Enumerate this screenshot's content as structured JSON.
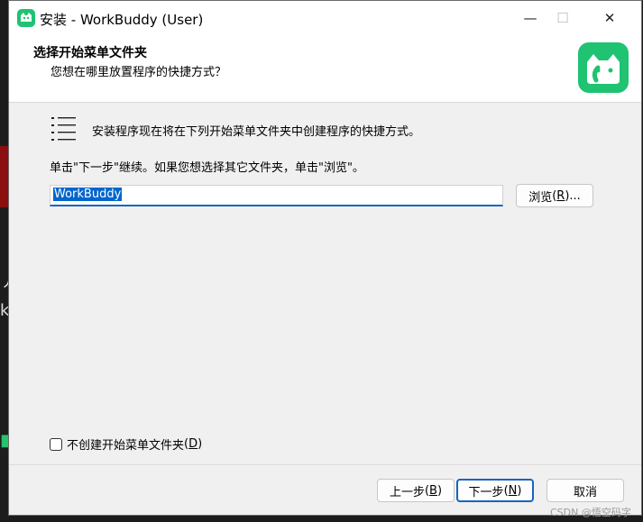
{
  "window": {
    "title": "安装 - WorkBuddy (User)",
    "minimize_glyph": "—",
    "maximize_glyph": "☐",
    "close_glyph": "✕"
  },
  "header": {
    "title": "选择开始菜单文件夹",
    "subtitle": "您想在哪里放置程序的快捷方式？",
    "logo_icon": "workbuddy-logo-icon"
  },
  "body": {
    "intro": "安装程序现在将在下列开始菜单文件夹中创建程序的快捷方式。",
    "instruction": "单击\"下一步\"继续。如果您想选择其它文件夹，单击\"浏览\"。",
    "folder_value": "WorkBuddy",
    "browse_label": "浏览",
    "browse_key": "R",
    "browse_suffix": "...",
    "no_folder_checkbox_label": "不创建开始菜单文件夹",
    "no_folder_key": "D",
    "no_folder_checked": false
  },
  "footer": {
    "back_label": "上一步",
    "back_key": "B",
    "next_label": "下一步",
    "next_key": "N",
    "cancel_label": "取消"
  },
  "watermark": "CSDN @悟空码字",
  "colors": {
    "accent": "#1565c0",
    "brand_green": "#1fc372",
    "selection": "#0066cc"
  }
}
